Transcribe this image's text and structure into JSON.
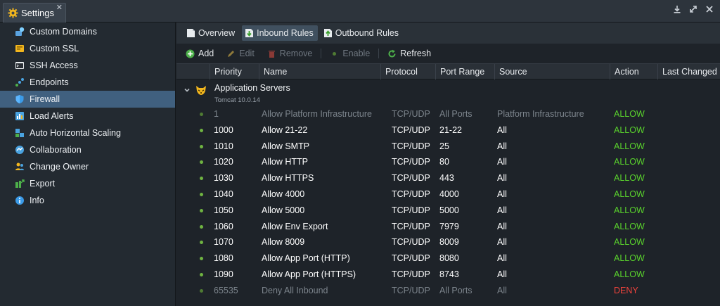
{
  "window": {
    "title": "Settings",
    "close_glyph": "✕",
    "icons": [
      "gear-icon",
      "download-icon",
      "expand-icon",
      "close-icon"
    ]
  },
  "sidebar": {
    "items": [
      {
        "label": "Custom Domains",
        "icon": "domain-icon"
      },
      {
        "label": "Custom SSL",
        "icon": "ssl-certificate-icon"
      },
      {
        "label": "SSH Access",
        "icon": "ssh-terminal-icon"
      },
      {
        "label": "Endpoints",
        "icon": "endpoints-icon"
      },
      {
        "label": "Firewall",
        "icon": "firewall-shield-icon",
        "active": true
      },
      {
        "label": "Load Alerts",
        "icon": "load-alerts-icon"
      },
      {
        "label": "Auto Horizontal Scaling",
        "icon": "scaling-icon"
      },
      {
        "label": "Collaboration",
        "icon": "collaboration-icon"
      },
      {
        "label": "Change Owner",
        "icon": "change-owner-icon"
      },
      {
        "label": "Export",
        "icon": "export-icon"
      },
      {
        "label": "Info",
        "icon": "info-icon"
      }
    ]
  },
  "tabs": [
    {
      "label": "Overview",
      "icon": "document-icon"
    },
    {
      "label": "Inbound Rules",
      "icon": "inbound-arrow-icon",
      "active": true
    },
    {
      "label": "Outbound Rules",
      "icon": "outbound-arrow-icon"
    }
  ],
  "toolbar": {
    "add": "Add",
    "edit": "Edit",
    "remove": "Remove",
    "enable": "Enable",
    "refresh": "Refresh"
  },
  "columns": {
    "priority": "Priority",
    "name": "Name",
    "protocol": "Protocol",
    "port_range": "Port Range",
    "source": "Source",
    "action": "Action",
    "last_changed": "Last Changed"
  },
  "group": {
    "name": "Application Servers",
    "subtitle": "Tomcat 10.0.14",
    "icon": "tomcat-icon"
  },
  "rules": [
    {
      "priority": "1",
      "name": "Allow Platform Infrastructure",
      "protocol": "TCP/UDP",
      "ports": "All Ports",
      "source": "Platform Infrastructure",
      "action": "ALLOW",
      "dim": true
    },
    {
      "priority": "1000",
      "name": "Allow 21-22",
      "protocol": "TCP/UDP",
      "ports": "21-22",
      "source": "All",
      "action": "ALLOW"
    },
    {
      "priority": "1010",
      "name": "Allow SMTP",
      "protocol": "TCP/UDP",
      "ports": "25",
      "source": "All",
      "action": "ALLOW"
    },
    {
      "priority": "1020",
      "name": "Allow HTTP",
      "protocol": "TCP/UDP",
      "ports": "80",
      "source": "All",
      "action": "ALLOW"
    },
    {
      "priority": "1030",
      "name": "Allow HTTPS",
      "protocol": "TCP/UDP",
      "ports": "443",
      "source": "All",
      "action": "ALLOW"
    },
    {
      "priority": "1040",
      "name": "Allow 4000",
      "protocol": "TCP/UDP",
      "ports": "4000",
      "source": "All",
      "action": "ALLOW"
    },
    {
      "priority": "1050",
      "name": "Allow 5000",
      "protocol": "TCP/UDP",
      "ports": "5000",
      "source": "All",
      "action": "ALLOW"
    },
    {
      "priority": "1060",
      "name": "Allow Env Export",
      "protocol": "TCP/UDP",
      "ports": "7979",
      "source": "All",
      "action": "ALLOW"
    },
    {
      "priority": "1070",
      "name": "Allow 8009",
      "protocol": "TCP/UDP",
      "ports": "8009",
      "source": "All",
      "action": "ALLOW"
    },
    {
      "priority": "1080",
      "name": "Allow App Port (HTTP)",
      "protocol": "TCP/UDP",
      "ports": "8080",
      "source": "All",
      "action": "ALLOW"
    },
    {
      "priority": "1090",
      "name": "Allow App Port (HTTPS)",
      "protocol": "TCP/UDP",
      "ports": "8743",
      "source": "All",
      "action": "ALLOW"
    },
    {
      "priority": "65535",
      "name": "Deny All Inbound",
      "protocol": "TCP/UDP",
      "ports": "All Ports",
      "source": "All",
      "action": "DENY",
      "dim": true
    }
  ],
  "colors": {
    "accent_active": "#40607f",
    "allow": "#59d12c",
    "deny": "#f0433c"
  }
}
